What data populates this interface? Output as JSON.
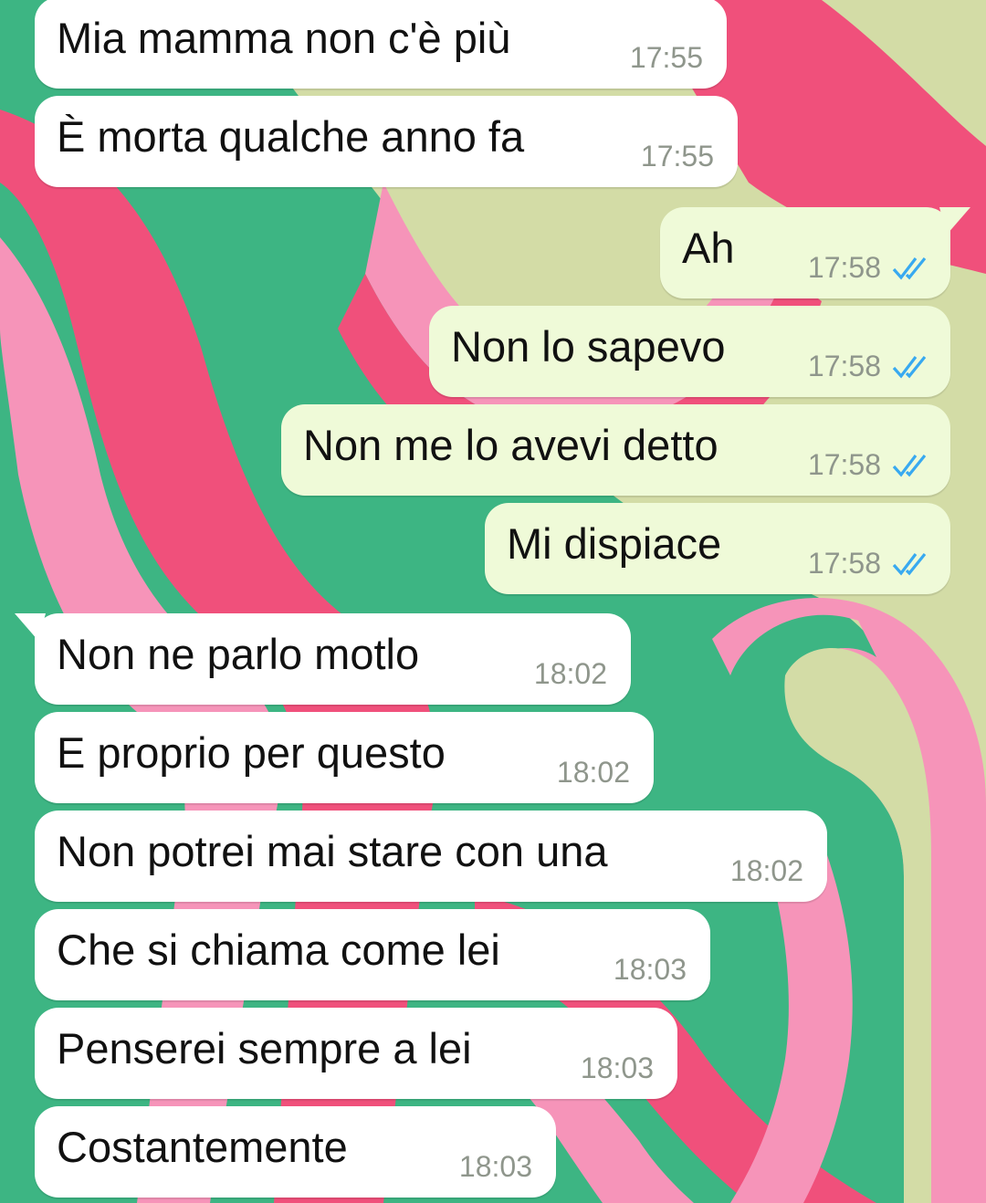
{
  "theme": {
    "incoming_bubble": "#ffffff",
    "outgoing_bubble": "#effad8",
    "read_tick_color": "#38a9f0",
    "timestamp_color": "#8f968c",
    "wallpaper_colors": [
      "#d3dca6",
      "#3db583",
      "#f0507b",
      "#f694b9"
    ]
  },
  "messages": [
    {
      "dir": "in",
      "text": "Mia mamma non c'è più",
      "time": "17:55"
    },
    {
      "dir": "in",
      "text": "È morta qualche anno fa",
      "time": "17:55"
    },
    {
      "dir": "out",
      "text": "Ah",
      "time": "17:58",
      "status_icon": "double-check-read-icon"
    },
    {
      "dir": "out",
      "text": "Non lo sapevo",
      "time": "17:58",
      "status_icon": "double-check-read-icon"
    },
    {
      "dir": "out",
      "text": "Non me lo avevi detto",
      "time": "17:58",
      "status_icon": "double-check-read-icon"
    },
    {
      "dir": "out",
      "text": "Mi dispiace",
      "time": "17:58",
      "status_icon": "double-check-read-icon"
    },
    {
      "dir": "in",
      "text": "Non ne parlo motlo",
      "time": "18:02"
    },
    {
      "dir": "in",
      "text": "E proprio per questo",
      "time": "18:02"
    },
    {
      "dir": "in",
      "text": "Non potrei mai stare con una",
      "time": "18:02"
    },
    {
      "dir": "in",
      "text": "Che si chiama come lei",
      "time": "18:03"
    },
    {
      "dir": "in",
      "text": "Penserei sempre a lei",
      "time": "18:03"
    },
    {
      "dir": "in",
      "text": "Costantemente",
      "time": "18:03"
    }
  ]
}
